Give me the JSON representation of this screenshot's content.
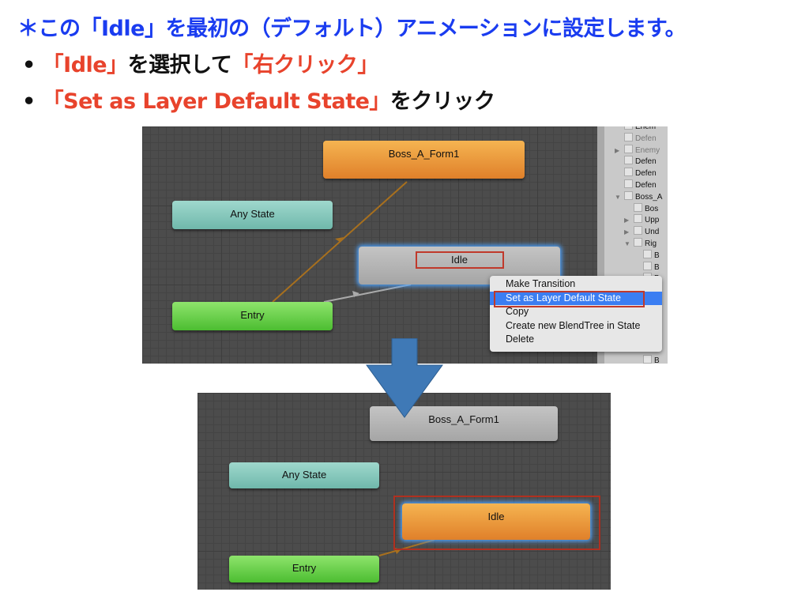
{
  "slide": {
    "title": "＊この「Idle」を最初の（デフォルト）アニメーションに設定します。",
    "bullets": [
      {
        "red": "「Idle」",
        "black": "を選択して",
        "red2": "「右クリック」"
      },
      {
        "red": "「Set as Layer Default State」",
        "black": "をクリック"
      }
    ],
    "bullet_mark": "•"
  },
  "before": {
    "nodes": {
      "boss": "Boss_A_Form1",
      "any": "Any State",
      "idle": "Idle",
      "entry": "Entry"
    },
    "context_menu": [
      "Make Transition",
      "Set as Layer Default State",
      "Copy",
      "Create new BlendTree in State",
      "Delete"
    ],
    "selected_menu_item": "Set as Layer Default State",
    "hierarchy": [
      "Enem",
      "Defen",
      "Enemy",
      "Defen",
      "Defen",
      "Defen",
      "Boss_A",
      "Bos",
      "Upp",
      "Und",
      "Rig",
      "B",
      "B",
      "B",
      "B",
      "B",
      "f",
      "B",
      "B",
      "B",
      "B"
    ]
  },
  "after": {
    "nodes": {
      "boss": "Boss_A_Form1",
      "any": "Any State",
      "idle": "Idle",
      "entry": "Entry"
    }
  },
  "colors": {
    "title": "#1a3cf0",
    "highlight": "#e8432c",
    "arrow": "#3f79b6",
    "default_state": "#e0802a"
  }
}
